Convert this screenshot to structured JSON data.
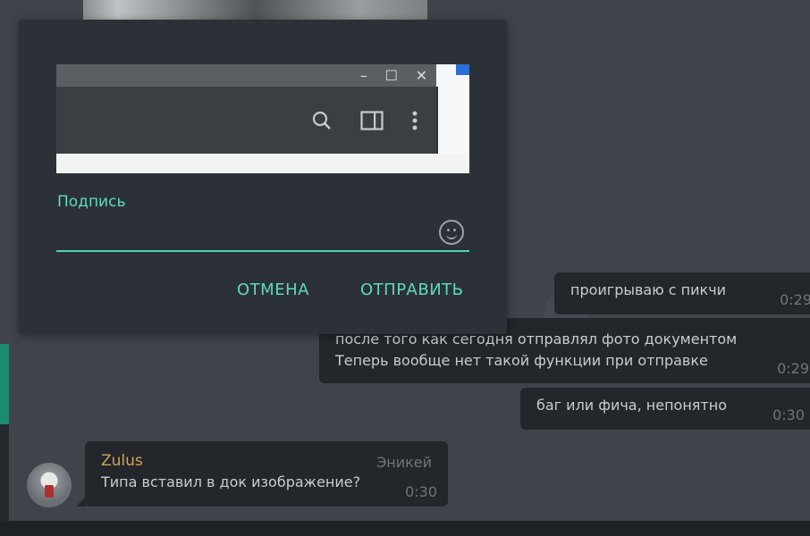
{
  "dialog": {
    "caption_label": "Подпись",
    "caption_value": "",
    "cancel_label": "ОТМЕНА",
    "send_label": "ОТПРАВИТЬ",
    "accent_color": "#4fd1b8"
  },
  "messages": [
    {
      "text": "проигрываю с пикчи",
      "time": "0:29"
    },
    {
      "text": "после того как сегодня отправлял фото документом",
      "text2": "Теперь вообще нет такой функции при отправке",
      "time": "0:29"
    },
    {
      "text": "баг или фича, непонятно",
      "time": "0:30"
    },
    {
      "sender": "Zulus",
      "role": "Эникей",
      "text": "Типа вставил в док изображение?",
      "time": "0:30"
    }
  ],
  "preview": {
    "icons": [
      "minimize-icon",
      "maximize-icon",
      "close-icon",
      "search-icon",
      "sidebar-icon",
      "more-vert-icon"
    ]
  }
}
